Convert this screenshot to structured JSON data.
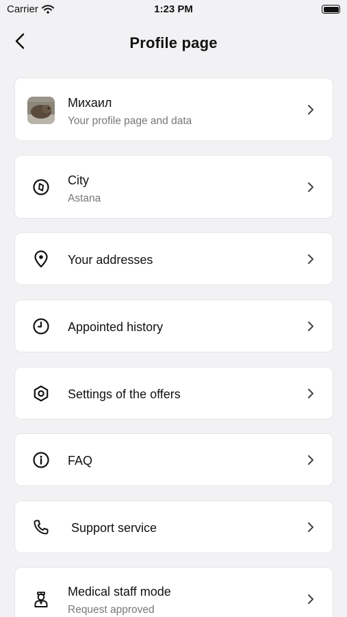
{
  "status_bar": {
    "carrier": "Carrier",
    "time": "1:23 PM"
  },
  "nav": {
    "title": "Profile page"
  },
  "menu": {
    "profile": {
      "name": "Михаил",
      "subtitle": "Your profile page and data"
    },
    "city": {
      "label": "City",
      "value": "Astana",
      "icon": "compass-icon"
    },
    "addresses": {
      "label": "Your addresses",
      "icon": "location-pin-icon"
    },
    "history": {
      "label": "Appointed history",
      "icon": "clock-icon"
    },
    "offers": {
      "label": "Settings of the offers",
      "icon": "settings-hexagon-icon"
    },
    "faq": {
      "label": "FAQ",
      "icon": "info-icon"
    },
    "support": {
      "label": "Support service",
      "icon": "phone-icon"
    },
    "medical": {
      "label": "Medical staff mode",
      "status": "Request approved",
      "icon": "doctor-icon"
    }
  },
  "colors": {
    "background": "#f2f2f4",
    "card": "#ffffff",
    "subtitle": "#777777"
  }
}
